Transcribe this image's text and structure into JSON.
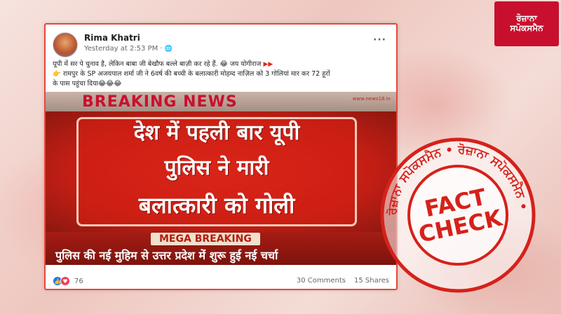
{
  "logo": {
    "line1": "ਰੋਜ਼ਾਨਾ",
    "line2": "ਸਪੋਕਸਮੈਨ"
  },
  "post": {
    "author": "Rima Khatri",
    "time": "Yesterday at 2:53 PM",
    "text_line1": "यूपी में सर पे चुनाव है, लेकिन बाबा जी बेखौफ बल्ले बाज़ी कर रहे हैं. 😂 जय योगीराज",
    "text_line2": "👉 रामपुर के SP अजयपाल शर्मा जी ने 6वर्ष की बच्ची के बलात्कारी मोहम्द नाज़िल को 3 गोलियां मार कर 72 हूरों",
    "text_line3": "के पास पहुंचा दिया😂😂😂",
    "reaction_count": "76",
    "comments": "30 Comments",
    "shares": "15 Shares"
  },
  "news_image": {
    "banner": "BREAKING NEWS",
    "site": "www.news18.in",
    "headline_1": "देश में पहली बार यूपी",
    "headline_2": "पुलिस ने मारी",
    "headline_3": "बलात्कारी को गोली",
    "mega": "MEGA BREAKING",
    "ticker": "पुलिस की नई मुहिम से उत्तर प्रदेश में शुरू हुई नई चर्चा"
  },
  "stamp": {
    "word1": "FACT",
    "word2": "CHECK",
    "ring_text": "ਰੋਜ਼ਾਨਾ ਸਪੋਕਸਮੈਨ • ਰੋਜ਼ਾਨਾ ਸਪੋਕਸਮੈਨ •",
    "color": "#d6211a"
  }
}
